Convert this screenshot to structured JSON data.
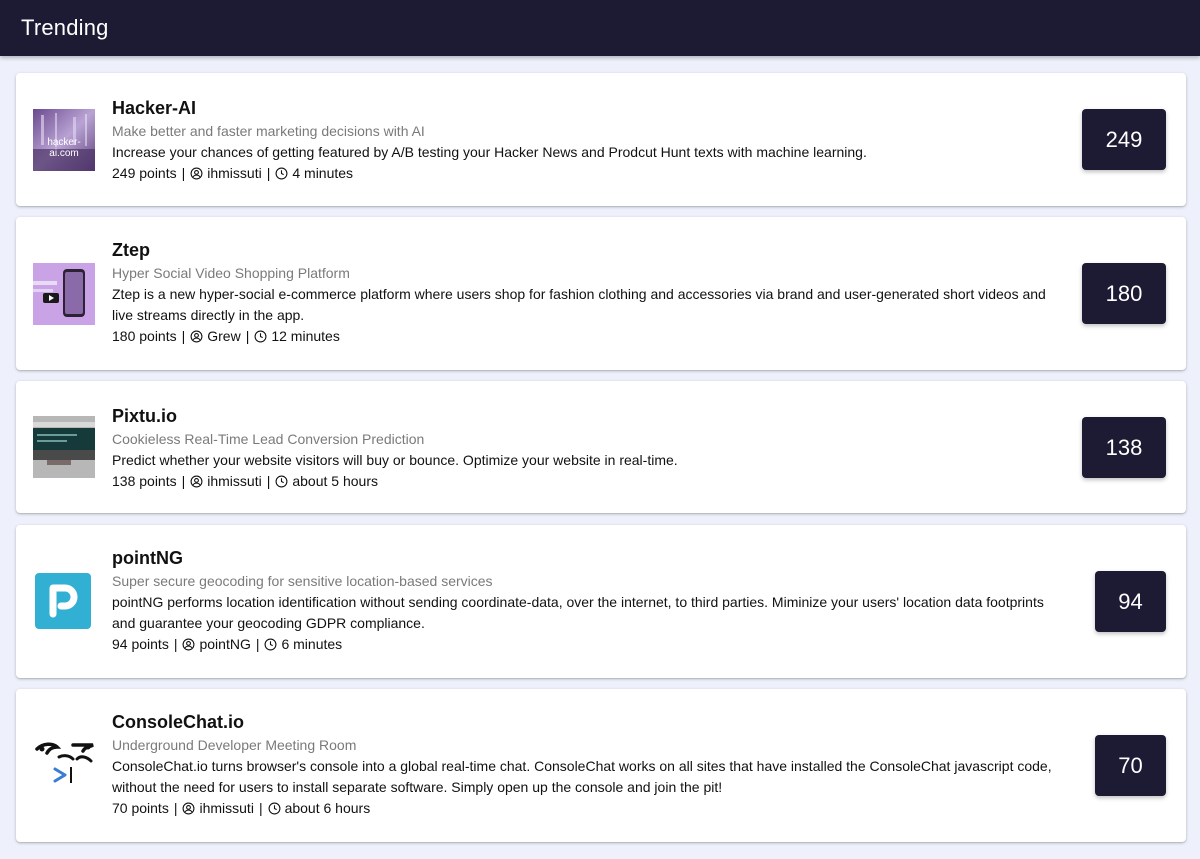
{
  "appbar": {
    "title": "Trending"
  },
  "posts": [
    {
      "name": "Hacker-AI",
      "tagline": "Make better and faster marketing decisions with AI",
      "description": "Increase your chances of getting featured by A/B testing your Hacker News and Prodcut Hunt texts with machine learning.",
      "points": "249 points",
      "author": "ihmissuti",
      "time": "4 minutes",
      "score": "249",
      "thumb_text": "hacker-ai.com"
    },
    {
      "name": "Ztep",
      "tagline": "Hyper Social Video Shopping Platform",
      "description": "Ztep is a new hyper-social e-commerce platform where users shop for fashion clothing and accessories via brand and user-generated short videos and live streams directly in the app.",
      "points": "180 points",
      "author": "Grew",
      "time": "12 minutes",
      "score": "180"
    },
    {
      "name": "Pixtu.io",
      "tagline": "Cookieless Real-Time Lead Conversion Prediction",
      "description": "Predict whether your website visitors will buy or bounce. Optimize your website in real-time.",
      "points": "138 points",
      "author": "ihmissuti",
      "time": "about 5 hours",
      "score": "138"
    },
    {
      "name": "pointNG",
      "tagline": "Super secure geocoding for sensitive location-based services",
      "description": "pointNG performs location identification without sending coordinate-data, over the internet, to third parties. Miminize your users' location data footprints and guarantee your geocoding GDPR compliance.",
      "points": "94 points",
      "author": "pointNG",
      "time": "6 minutes",
      "score": "94"
    },
    {
      "name": "ConsoleChat.io",
      "tagline": "Underground Developer Meeting Room",
      "description": "ConsoleChat.io turns browser's console into a global real-time chat. ConsoleChat works on all sites that have installed the ConsoleChat javascript code, without the need for users to install separate software. Simply open up the console and join the pit!",
      "points": "70 points",
      "author": "ihmissuti",
      "time": "about 6 hours",
      "score": "70"
    }
  ],
  "colors": {
    "appbar": "#1c1b33",
    "background": "#eef0fb",
    "score_button": "#1c1b33",
    "tagline": "#7a7a7a"
  },
  "icons": {
    "author": "account-circle-icon",
    "time": "clock-icon"
  }
}
